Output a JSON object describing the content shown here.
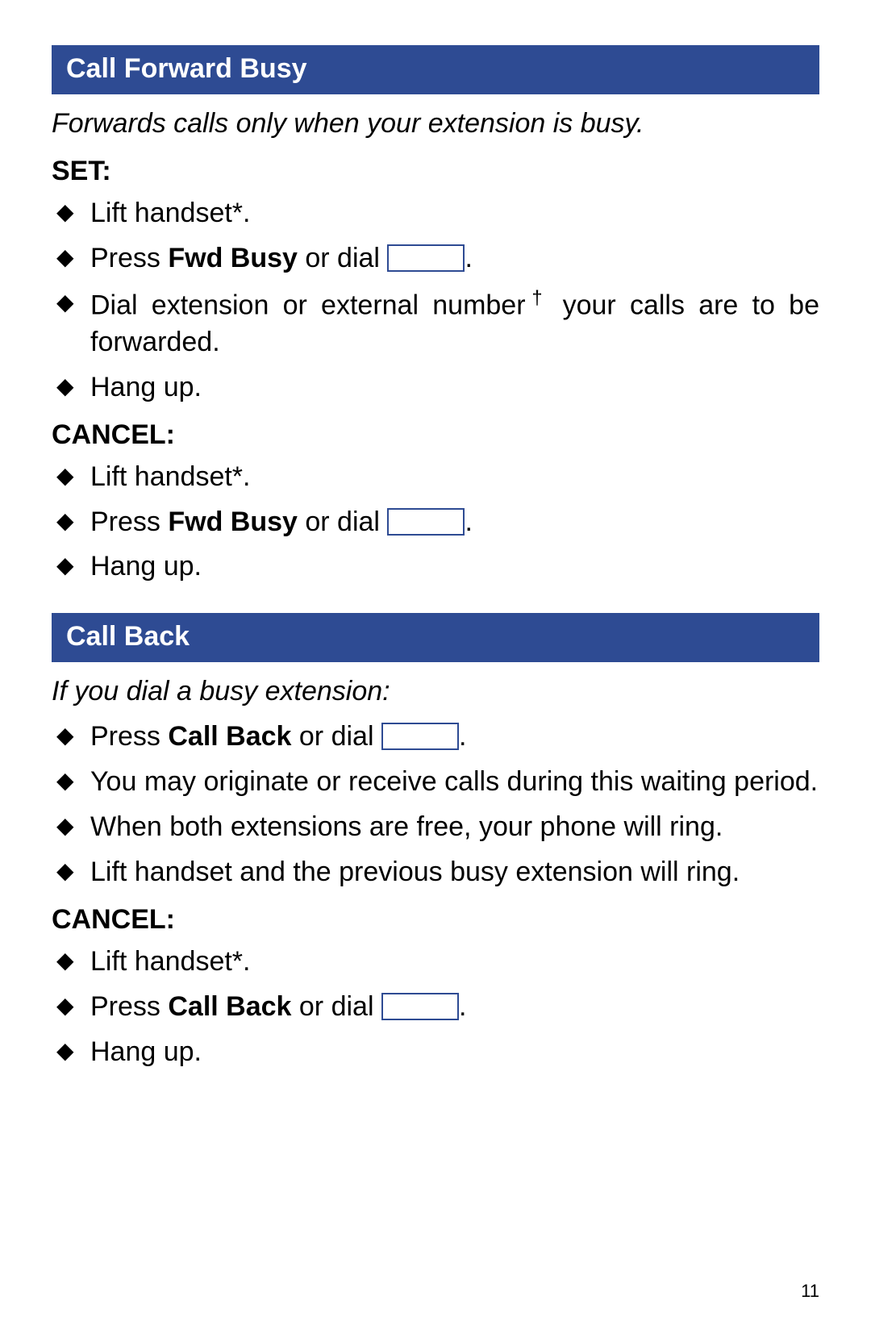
{
  "page_number": "11",
  "sections": [
    {
      "heading": "Call Forward Busy",
      "intro": "Forwards calls only when your extension is busy.",
      "groups": [
        {
          "label": "SET:",
          "items": [
            {
              "parts": [
                {
                  "t": "Lift handset*."
                }
              ]
            },
            {
              "parts": [
                {
                  "t": "Press "
                },
                {
                  "t": "Fwd Busy",
                  "b": true
                },
                {
                  "t": " or dial "
                },
                {
                  "box": true
                },
                {
                  "t": "."
                }
              ]
            },
            {
              "parts": [
                {
                  "t": "Dial extension or external number"
                },
                {
                  "t": "†",
                  "sup": true
                },
                {
                  "t": " your calls are to be forwarded."
                }
              ]
            },
            {
              "parts": [
                {
                  "t": "Hang up."
                }
              ]
            }
          ]
        },
        {
          "label": "CANCEL:",
          "items": [
            {
              "parts": [
                {
                  "t": "Lift handset*."
                }
              ]
            },
            {
              "parts": [
                {
                  "t": "Press "
                },
                {
                  "t": "Fwd Busy",
                  "b": true
                },
                {
                  "t": " or dial "
                },
                {
                  "box": true
                },
                {
                  "t": "."
                }
              ]
            },
            {
              "parts": [
                {
                  "t": "Hang up."
                }
              ]
            }
          ]
        }
      ]
    },
    {
      "heading": "Call Back",
      "intro": "If you dial a busy extension:",
      "groups": [
        {
          "label": "",
          "items": [
            {
              "parts": [
                {
                  "t": "Press "
                },
                {
                  "t": "Call Back",
                  "b": true
                },
                {
                  "t": " or dial "
                },
                {
                  "box": true
                },
                {
                  "t": "."
                }
              ]
            },
            {
              "parts": [
                {
                  "t": "You may originate or receive calls during this waiting period."
                }
              ]
            },
            {
              "parts": [
                {
                  "t": "When both extensions are free, your phone will ring."
                }
              ]
            },
            {
              "parts": [
                {
                  "t": "Lift handset and the previous busy extension will ring."
                }
              ]
            }
          ]
        },
        {
          "label": "CANCEL:",
          "items": [
            {
              "parts": [
                {
                  "t": "Lift handset*."
                }
              ]
            },
            {
              "parts": [
                {
                  "t": "Press "
                },
                {
                  "t": "Call Back",
                  "b": true
                },
                {
                  "t": " or dial "
                },
                {
                  "box": true
                },
                {
                  "t": "."
                }
              ]
            },
            {
              "parts": [
                {
                  "t": "Hang up."
                }
              ]
            }
          ]
        }
      ]
    }
  ]
}
